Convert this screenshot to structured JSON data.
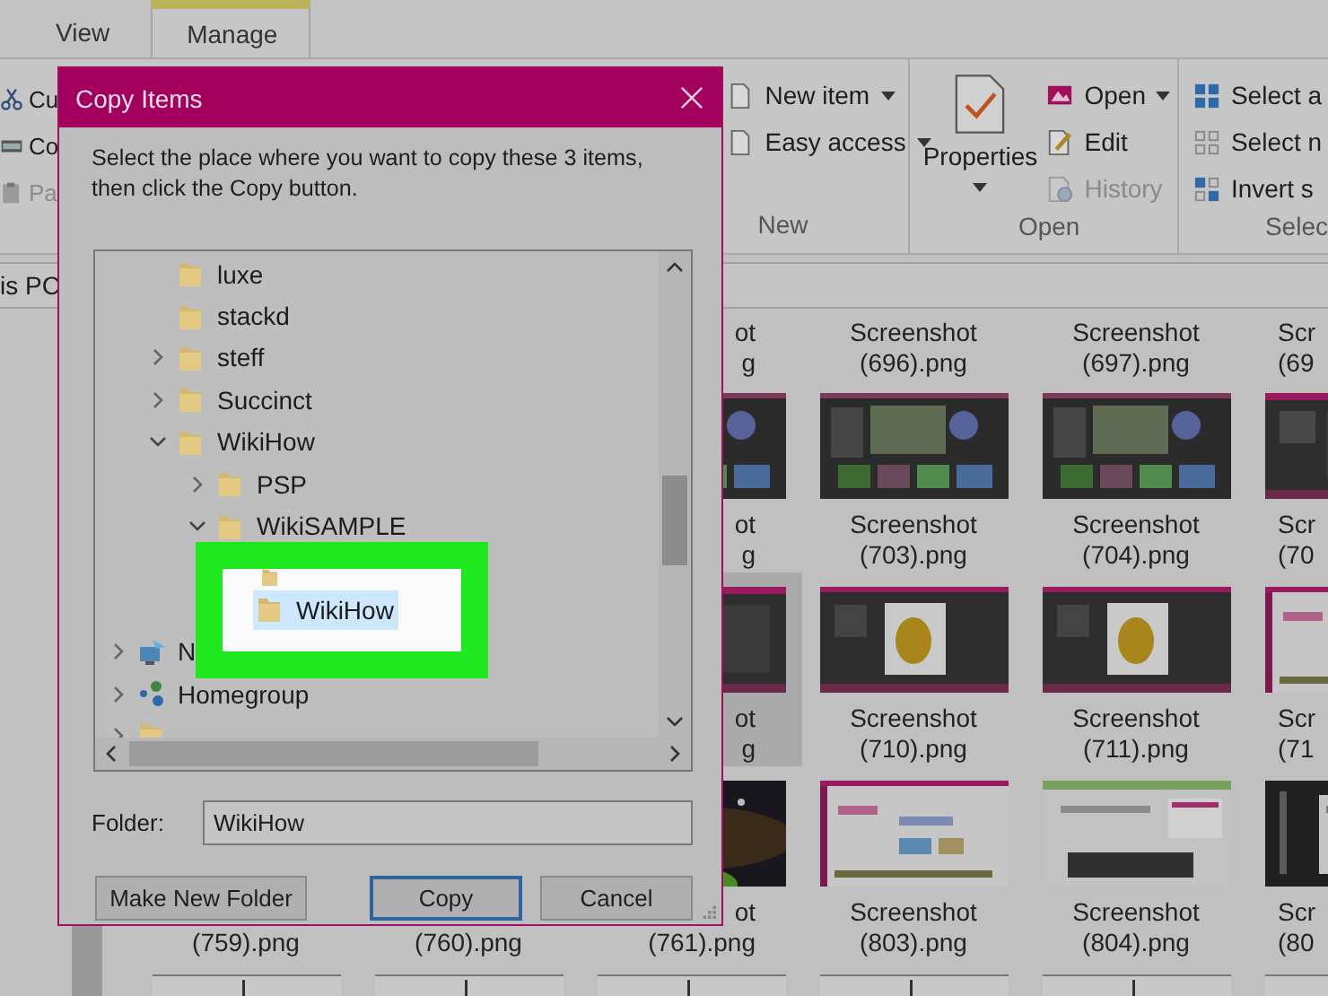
{
  "explorer": {
    "tabs": [
      {
        "label": "View",
        "selected": false
      },
      {
        "label": "Manage",
        "selected": true
      }
    ],
    "ribbon": {
      "clipboard": [
        {
          "label": "Cu",
          "disabled": false
        },
        {
          "label": "Co",
          "disabled": false
        },
        {
          "label": "Pa",
          "disabled": true
        }
      ],
      "groups": [
        {
          "label": "New",
          "items": [
            {
              "label": "New item",
              "dropdown": true,
              "disabled": false
            },
            {
              "label": "Easy access",
              "dropdown": true,
              "disabled": false
            }
          ]
        },
        {
          "label": "Open",
          "large": {
            "label": "Properties",
            "dropdown": true
          },
          "items": [
            {
              "label": "Open",
              "dropdown": true,
              "disabled": false
            },
            {
              "label": "Edit",
              "dropdown": false,
              "disabled": false
            },
            {
              "label": "History",
              "dropdown": false,
              "disabled": true
            }
          ]
        },
        {
          "label": "Selec",
          "items": [
            {
              "label": "Select a",
              "dropdown": false,
              "disabled": false
            },
            {
              "label": "Select n",
              "dropdown": false,
              "disabled": false
            },
            {
              "label": "Invert s",
              "dropdown": false,
              "disabled": false
            }
          ]
        }
      ]
    },
    "address": "is PC",
    "files": [
      {
        "cells": [
          {
            "line1": "ot",
            "line2": "g",
            "selected": false
          },
          {
            "line1": "Screenshot",
            "line2": "(696).png",
            "selected": false
          },
          {
            "line1": "Screenshot",
            "line2": "(697).png",
            "selected": false
          },
          {
            "line1": "Scr",
            "line2": "(69",
            "selected": false
          }
        ]
      },
      {
        "cells": [
          {
            "line1": "ot",
            "line2": "g",
            "selected": false
          },
          {
            "line1": "Screenshot",
            "line2": "(703).png",
            "selected": false
          },
          {
            "line1": "Screenshot",
            "line2": "(704).png",
            "selected": false
          },
          {
            "line1": "Scr",
            "line2": "(70",
            "selected": false
          }
        ]
      },
      {
        "cells": [
          {
            "line1": "ot",
            "line2": "g",
            "selected": true
          },
          {
            "line1": "Screenshot",
            "line2": "(710).png",
            "selected": false
          },
          {
            "line1": "Screenshot",
            "line2": "(711).png",
            "selected": false
          },
          {
            "line1": "Scr",
            "line2": "(71",
            "selected": false
          }
        ]
      },
      {
        "cells": [
          {
            "line2": "(759).png",
            "selected": false
          },
          {
            "line2": "(760).png",
            "selected": false
          },
          {
            "line1": "ot",
            "line2": "(761).png",
            "selected": false
          },
          {
            "line1": "Screenshot",
            "line2": "(803).png",
            "selected": false
          },
          {
            "line1": "Screenshot",
            "line2": "(804).png",
            "selected": false
          },
          {
            "line1": "Scr",
            "line2": "(80",
            "selected": false
          }
        ]
      }
    ]
  },
  "dialog": {
    "title": "Copy Items",
    "instruction": "Select the place where you want to copy these 3 items, then click the Copy button.",
    "tree": [
      {
        "children": [
          {
            "kind": "folder",
            "label": "luxe",
            "selected": false
          },
          {
            "kind": "folder",
            "label": "stackd",
            "selected": false
          },
          {
            "kind": "folder",
            "label": "steff",
            "expanded": false,
            "selected": false
          },
          {
            "kind": "folder",
            "label": "Succinct",
            "expanded": false,
            "selected": false
          },
          {
            "kind": "folder",
            "label": "WikiHow",
            "expanded": true,
            "selected": false,
            "children": [
              {
                "kind": "folder",
                "label": "PSP",
                "expanded": false,
                "selected": false
              },
              {
                "kind": "folder",
                "label": "WikiSAMPLE",
                "expanded": true,
                "selected": false,
                "children": [
                  {
                    "kind": "folder",
                    "selected": false
                  },
                  {
                    "kind": "folder",
                    "label": "WikiHow",
                    "selected": true
                  }
                ]
              }
            ]
          }
        ]
      },
      {
        "kind": "network",
        "label": "N",
        "expanded": false,
        "selected": false
      },
      {
        "kind": "homegroup",
        "label": "Homegroup",
        "expanded": false,
        "selected": false
      },
      {
        "kind": "folder",
        "expanded": false,
        "selected": false
      }
    ],
    "folder_label": "Folder:",
    "folder_value": "WikiHow",
    "buttons": [
      {
        "label": "Make New Folder",
        "default": false
      },
      {
        "label": "Copy",
        "default": true
      },
      {
        "label": "Cancel",
        "default": false
      }
    ]
  }
}
